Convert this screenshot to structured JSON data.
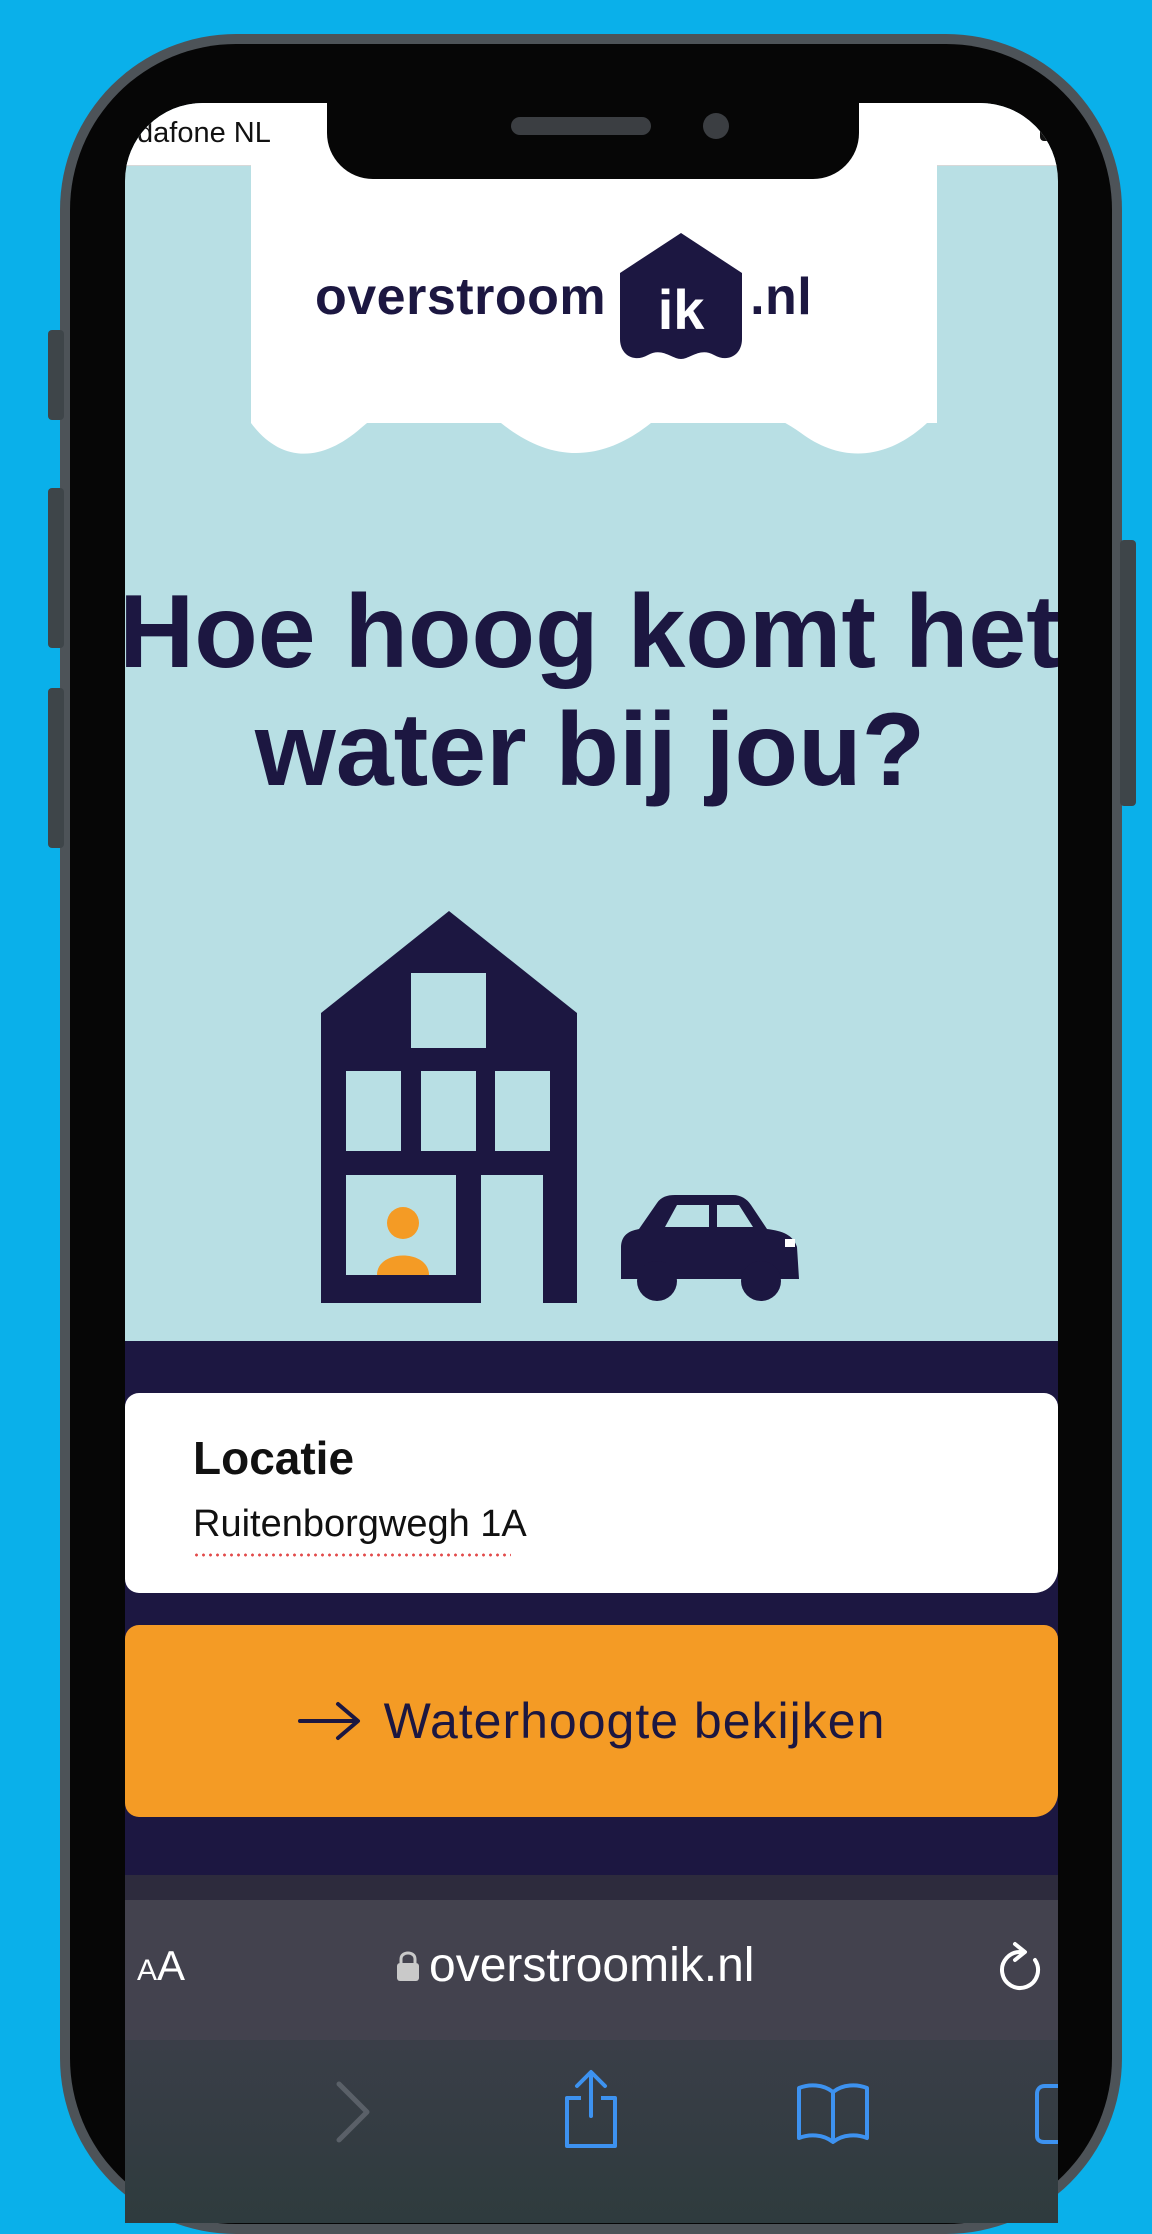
{
  "statusbar": {
    "carrier": "dafone NL"
  },
  "logo": {
    "left": "overstroom",
    "badge": "ik",
    "right": ".nl"
  },
  "hero": {
    "line1": "Hoe hoog komt het",
    "line2": "water bij jou?"
  },
  "location": {
    "title": "Locatie",
    "value": "Ruitenborgwegh 1A"
  },
  "cta": {
    "label": "Waterhoogte bekijken",
    "icon": "arrow-right-icon"
  },
  "browser": {
    "text_size_small": "A",
    "text_size_big": "A",
    "url": "overstroomik.nl",
    "toolbar_icons": [
      "forward-icon",
      "share-icon",
      "bookmarks-icon",
      "tabs-icon"
    ]
  },
  "colors": {
    "background": "#0AB0EA",
    "page": "#B8DFE4",
    "navy": "#1C1741",
    "orange": "#F49B25"
  }
}
